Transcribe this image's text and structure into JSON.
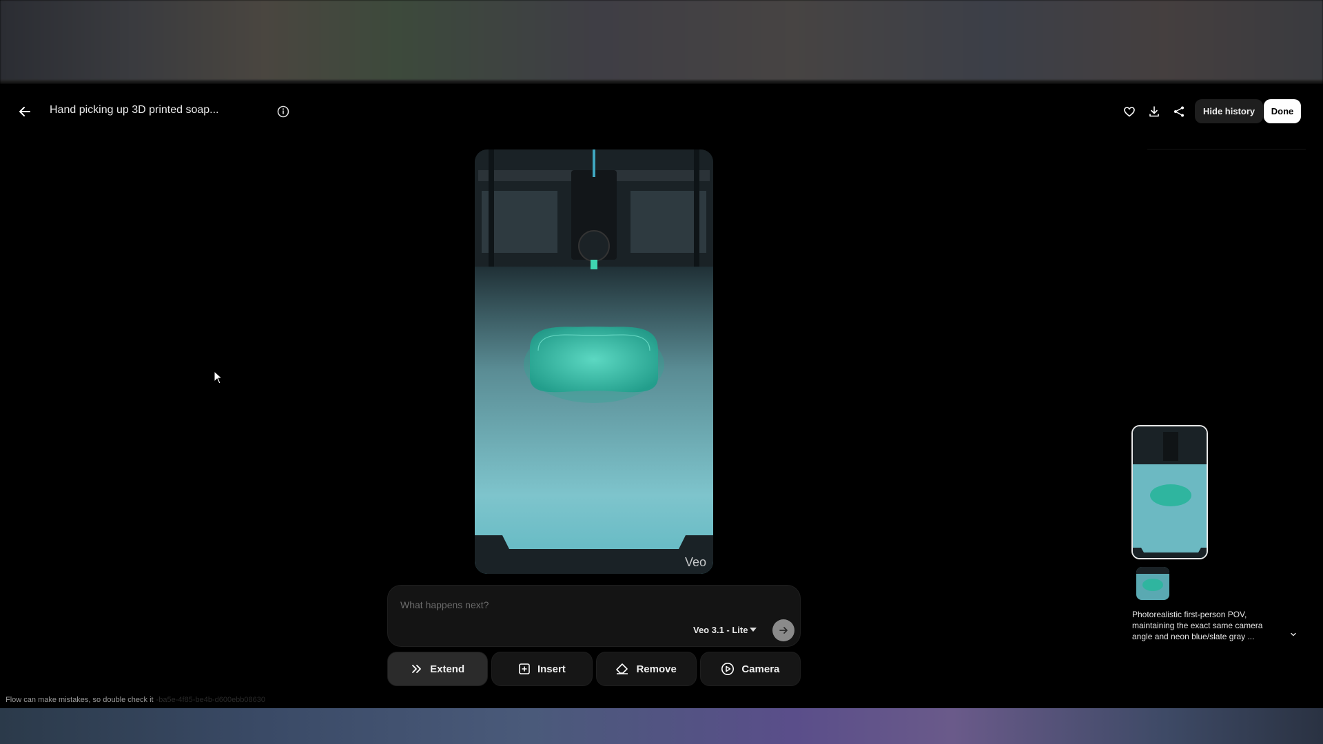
{
  "header": {
    "title": "Hand picking up 3D printed soap...",
    "icons": [
      "arrow-back-icon",
      "info-icon",
      "heart-icon",
      "download-icon",
      "share-icon"
    ],
    "hide_history_label": "Hide history",
    "done_label": "Done"
  },
  "video": {
    "watermark": "Veo"
  },
  "prompt": {
    "placeholder": "What happens next?",
    "model": "Veo 3.1 - Lite"
  },
  "actions": [
    {
      "label": "Extend",
      "icon": "double-chevron-right-icon",
      "active": true
    },
    {
      "label": "Insert",
      "icon": "add-box-icon",
      "active": false
    },
    {
      "label": "Remove",
      "icon": "eraser-icon",
      "active": false
    },
    {
      "label": "Camera",
      "icon": "play-circle-icon",
      "active": false
    }
  ],
  "footer": {
    "disclaimer": "Flow can make mistakes, so double check it",
    "faint_id": "-ba5e-4f85-be4b-d600ebb08630"
  },
  "history": {
    "description": "Photorealistic first-person POV, maintaining the exact same camera angle and neon blue/slate gray ..."
  },
  "colors": {
    "background": "#000000",
    "accent_teal": "#3fbfb0",
    "button_bg": "#161616",
    "active_button_bg": "#2b2b2b"
  }
}
